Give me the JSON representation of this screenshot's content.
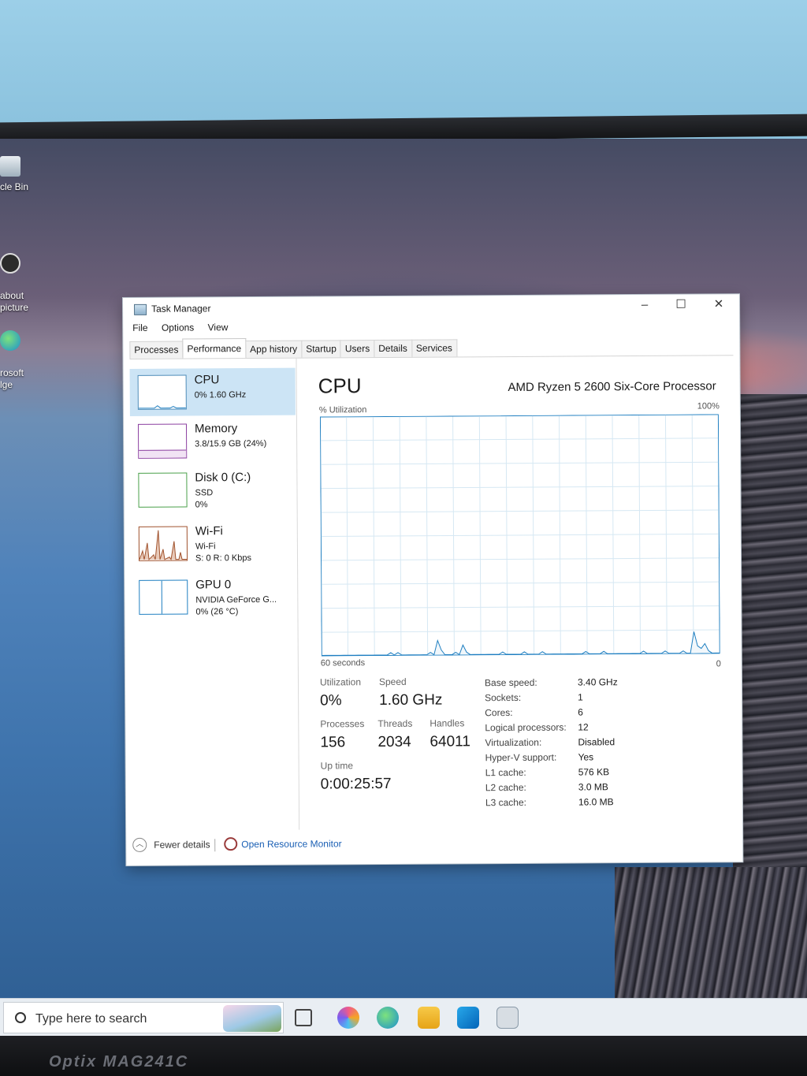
{
  "desktop": {
    "icons": [
      {
        "label": "cle Bin",
        "icon": "recycle-bin-icon"
      },
      {
        "label": "about\npicture",
        "icon": "picture-icon"
      },
      {
        "label": "rosoft\nlge",
        "icon": "edge-icon"
      }
    ]
  },
  "window": {
    "title": "Task Manager",
    "controls": {
      "minimize": "–",
      "maximize": "☐",
      "close": "✕"
    },
    "menu": [
      "File",
      "Options",
      "View"
    ],
    "tabs": [
      "Processes",
      "Performance",
      "App history",
      "Startup",
      "Users",
      "Details",
      "Services"
    ],
    "active_tab": "Performance"
  },
  "sidebar": {
    "items": [
      {
        "name": "CPU",
        "line1": "0% 1.60 GHz",
        "line2": ""
      },
      {
        "name": "Memory",
        "line1": "3.8/15.9 GB (24%)",
        "line2": ""
      },
      {
        "name": "Disk 0 (C:)",
        "line1": "SSD",
        "line2": "0%"
      },
      {
        "name": "Wi-Fi",
        "line1": "Wi-Fi",
        "line2": "S: 0 R: 0 Kbps"
      },
      {
        "name": "GPU 0",
        "line1": "NVIDIA GeForce G...",
        "line2": "0% (26 °C)"
      }
    ],
    "selected": "CPU"
  },
  "cpu": {
    "title": "CPU",
    "model": "AMD Ryzen 5 2600 Six-Core Processor",
    "y_axis_label": "% Utilization",
    "y_max_label": "100%",
    "x_axis_label": "60 seconds",
    "x_min_label": "0",
    "utilization_history": [
      0,
      0,
      0,
      0,
      0,
      0,
      0,
      0,
      0,
      0,
      0,
      0,
      0,
      0,
      0,
      0,
      0,
      0,
      0,
      1,
      0,
      1,
      0,
      0,
      0,
      0,
      0,
      0,
      0,
      0,
      1,
      0,
      6,
      2,
      0,
      0,
      0,
      1,
      0,
      4,
      1,
      0,
      0,
      0,
      0,
      0,
      0,
      0,
      0,
      0,
      1,
      0,
      0,
      0,
      0,
      0,
      1,
      0,
      0,
      0,
      0,
      1,
      0,
      0,
      0,
      0,
      0,
      0,
      0,
      0,
      0,
      0,
      0,
      1,
      0,
      0,
      0,
      0,
      1,
      0,
      0,
      0,
      0,
      0,
      0,
      0,
      0,
      0,
      0,
      1,
      0,
      0,
      0,
      0,
      0,
      1,
      0,
      0,
      0,
      0,
      1,
      0,
      0,
      9,
      3,
      2,
      4,
      1,
      0,
      0,
      0
    ]
  },
  "stats": {
    "utilization": {
      "label": "Utilization",
      "value": "0%"
    },
    "speed": {
      "label": "Speed",
      "value": "1.60 GHz"
    },
    "processes": {
      "label": "Processes",
      "value": "156"
    },
    "threads": {
      "label": "Threads",
      "value": "2034"
    },
    "handles": {
      "label": "Handles",
      "value": "64011"
    },
    "uptime": {
      "label": "Up time",
      "value": "0:00:25:57"
    }
  },
  "specs": [
    {
      "label": "Base speed:",
      "value": "3.40 GHz"
    },
    {
      "label": "Sockets:",
      "value": "1"
    },
    {
      "label": "Cores:",
      "value": "6"
    },
    {
      "label": "Logical processors:",
      "value": "12"
    },
    {
      "label": "Virtualization:",
      "value": "Disabled"
    },
    {
      "label": "Hyper-V support:",
      "value": "Yes"
    },
    {
      "label": "L1 cache:",
      "value": "576 KB"
    },
    {
      "label": "L2 cache:",
      "value": "3.0 MB"
    },
    {
      "label": "L3 cache:",
      "value": "16.0 MB"
    }
  ],
  "footer": {
    "fewer_details": "Fewer details",
    "open_resource_monitor": "Open Resource Monitor"
  },
  "taskbar": {
    "search_placeholder": "Type here to search",
    "apps": [
      "task-view-icon",
      "copilot-icon",
      "edge-icon",
      "file-explorer-icon",
      "outlook-icon",
      "task-manager-icon"
    ]
  },
  "monitor": {
    "brand": "Optix MAG241C"
  },
  "colors": {
    "cpu_line": "#1f7fc1",
    "grid": "#d6e8f3",
    "select": "#cce4f5",
    "wifi_bars": "#a0522d"
  }
}
